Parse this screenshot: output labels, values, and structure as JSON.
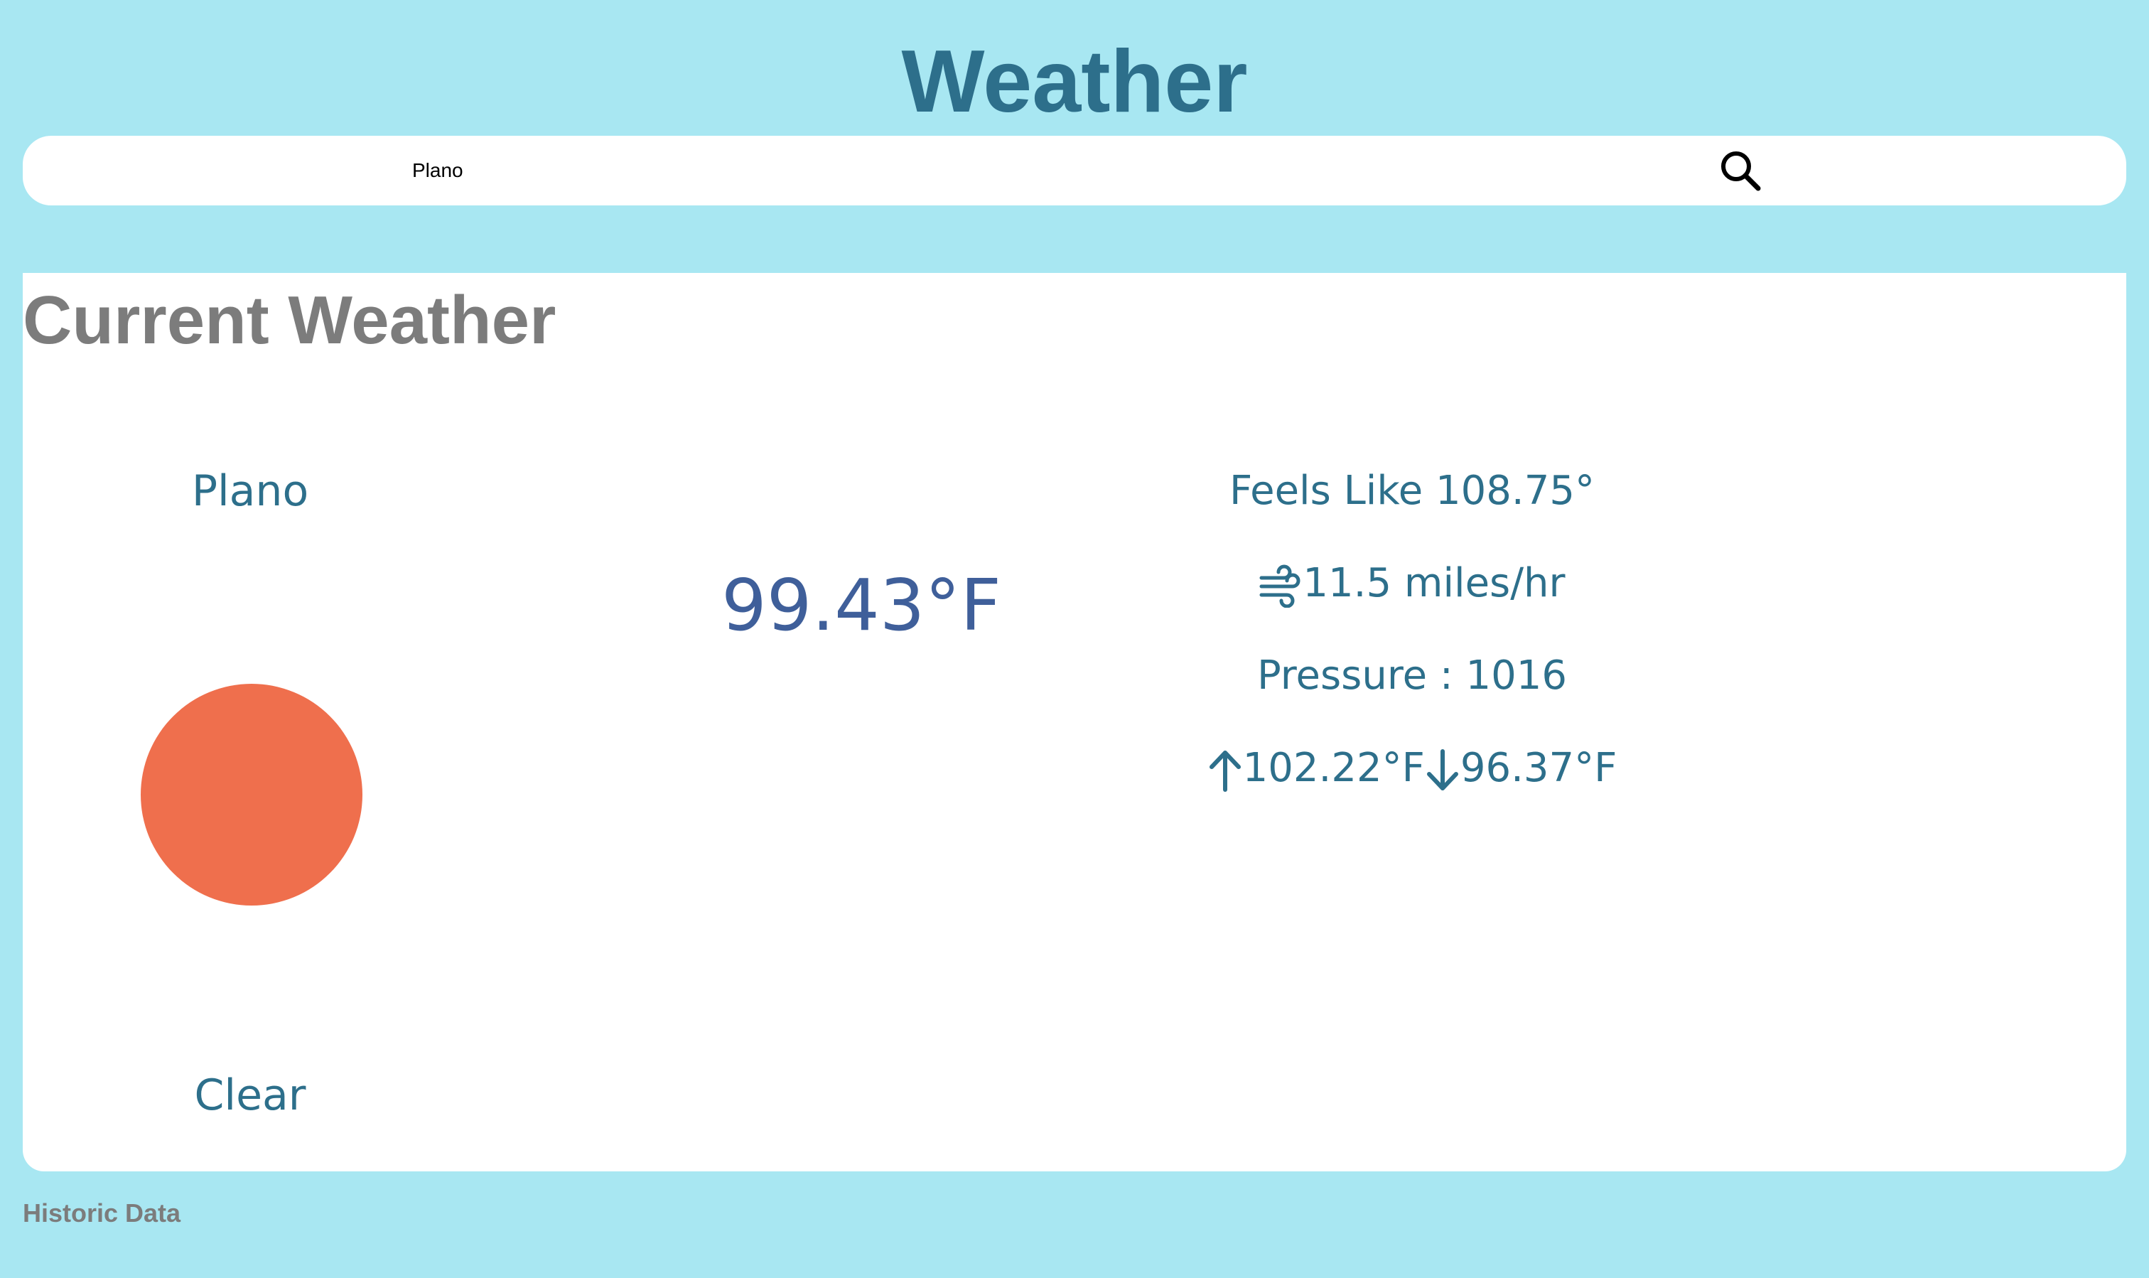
{
  "header": {
    "title": "Weather"
  },
  "search": {
    "value": "Plano",
    "placeholder": ""
  },
  "current": {
    "heading": "Current Weather",
    "city": "Plano",
    "condition": "Clear",
    "temperature": "99.43°F",
    "feels_like": "Feels Like 108.75°",
    "wind": "11.5 miles/hr",
    "pressure": "Pressure : 1016",
    "high": "102.22°F",
    "low": "96.37°F",
    "icon": "sun-icon",
    "icon_color": "#ef6f4d"
  },
  "footer": {
    "historic_label": "Historic Data"
  },
  "colors": {
    "background": "#a8e7f2",
    "title": "#2d6f8b",
    "temperature": "#3f5f9a",
    "heading": "#7c7c7c"
  }
}
